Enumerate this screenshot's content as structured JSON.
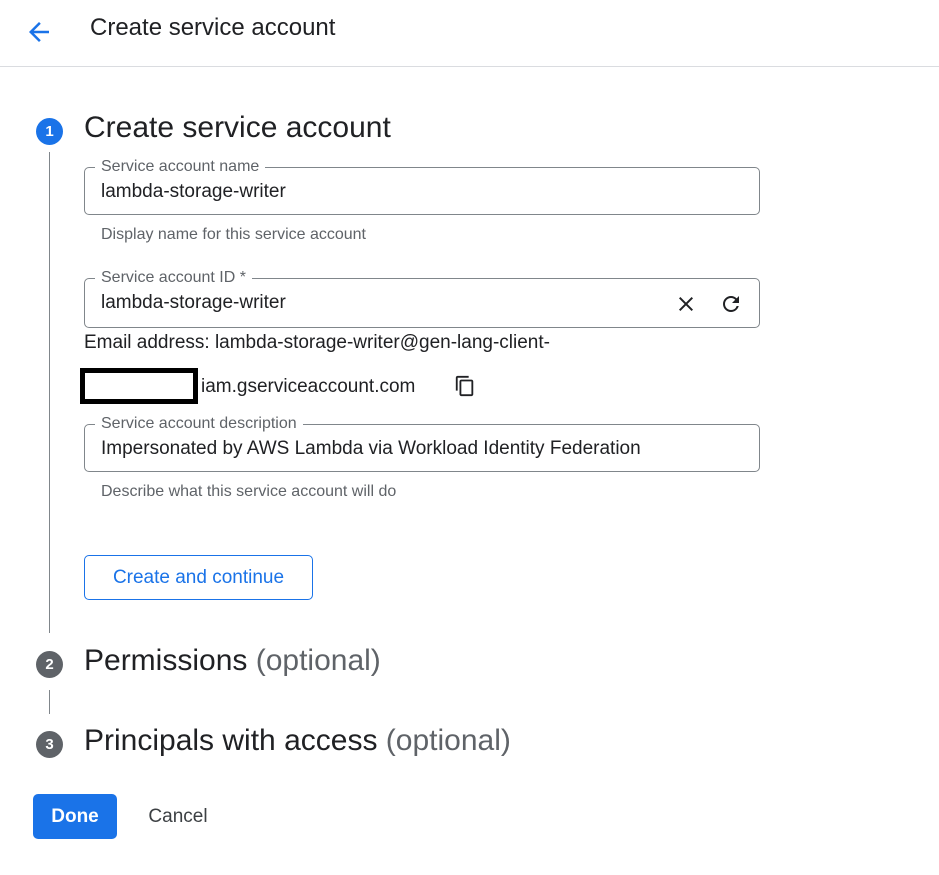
{
  "header": {
    "title": "Create service account"
  },
  "steps": [
    {
      "number": "1",
      "title": "Create service account",
      "optional": "",
      "state": "active"
    },
    {
      "number": "2",
      "title": "Permissions",
      "optional": "(optional)",
      "state": "inactive"
    },
    {
      "number": "3",
      "title": "Principals with access",
      "optional": "(optional)",
      "state": "inactive"
    }
  ],
  "form": {
    "name": {
      "label": "Service account name",
      "value": "lambda-storage-writer",
      "helper": "Display name for this service account"
    },
    "id": {
      "label": "Service account ID *",
      "value": "lambda-storage-writer"
    },
    "email": {
      "line1": "Email address: lambda-storage-writer@gen-lang-client-",
      "line2": "iam.gserviceaccount.com"
    },
    "description": {
      "label": "Service account description",
      "value": "Impersonated by AWS Lambda via Workload Identity Federation",
      "helper": "Describe what this service account will do"
    },
    "create_button": "Create and continue"
  },
  "footer": {
    "done_label": "Done",
    "cancel_label": "Cancel"
  },
  "icons": {
    "back": "arrow-back-icon",
    "clear": "close-icon",
    "refresh": "refresh-icon",
    "copy": "copy-icon"
  },
  "colors": {
    "accent": "#1a73e8",
    "inactive_step": "#5f6368",
    "text": "#202124",
    "muted": "#5f6368"
  }
}
